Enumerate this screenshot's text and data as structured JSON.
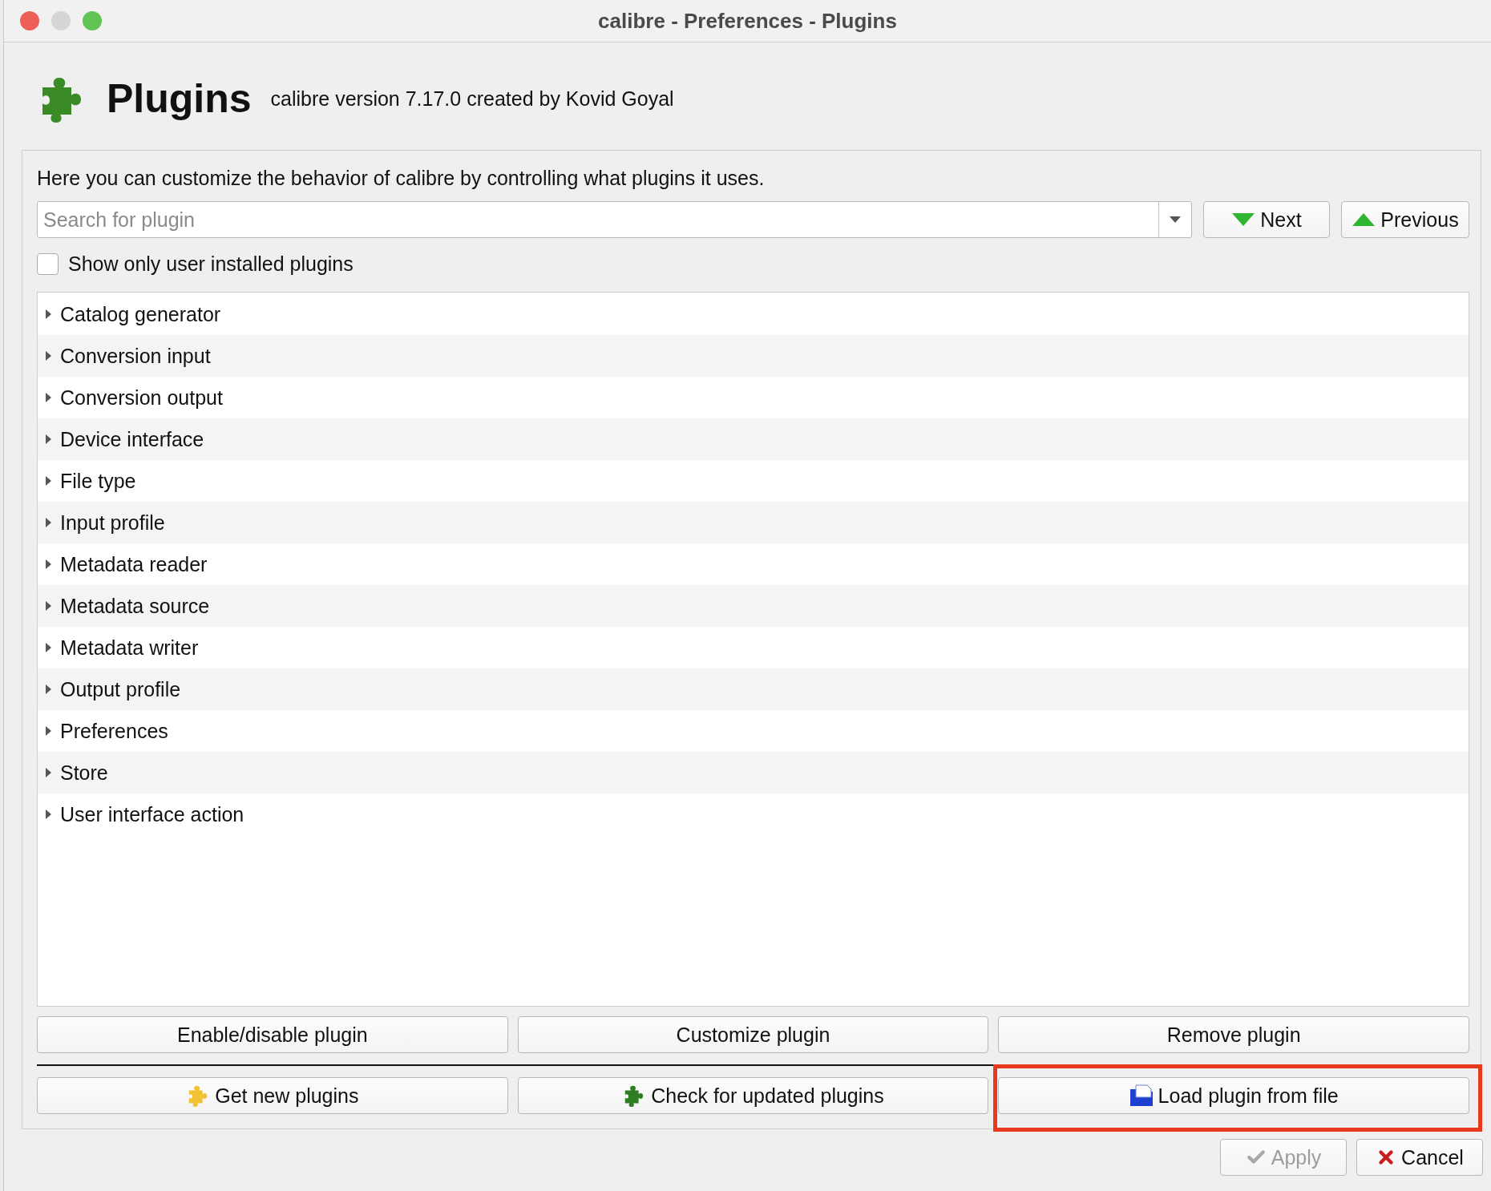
{
  "window": {
    "title": "calibre - Preferences - Plugins"
  },
  "header": {
    "title": "Plugins",
    "subtitle": "calibre version 7.17.0 created by Kovid Goyal"
  },
  "intro": "Here you can customize the behavior of calibre by controlling what plugins it uses.",
  "search": {
    "placeholder": "Search for plugin"
  },
  "nav_buttons": [
    {
      "kind": "down",
      "label": "Next"
    },
    {
      "kind": "up",
      "label": "Previous"
    }
  ],
  "filter": {
    "label": "Show only user installed plugins",
    "checked": false
  },
  "tree": [
    {
      "label": "Catalog generator",
      "expanded": false
    },
    {
      "label": "Conversion input",
      "expanded": false
    },
    {
      "label": "Conversion output",
      "expanded": false
    },
    {
      "label": "Device interface",
      "expanded": false
    },
    {
      "label": "File type",
      "expanded": false
    },
    {
      "label": "Input profile",
      "expanded": false
    },
    {
      "label": "Metadata reader",
      "expanded": false
    },
    {
      "label": "Metadata source",
      "expanded": false
    },
    {
      "label": "Metadata writer",
      "expanded": false
    },
    {
      "label": "Output profile",
      "expanded": false
    },
    {
      "label": "Preferences",
      "expanded": false
    },
    {
      "label": "Store",
      "expanded": false
    },
    {
      "label": "User interface action",
      "expanded": false
    }
  ],
  "plugin_buttons": [
    "Enable/disable plugin",
    "Customize plugin",
    "Remove plugin"
  ],
  "source_buttons": [
    {
      "kind": "get",
      "label": "Get new plugins",
      "highlighted": false
    },
    {
      "kind": "check",
      "label": "Check for updated plugins",
      "highlighted": false
    },
    {
      "kind": "load",
      "label": "Load plugin from file",
      "highlighted": true
    }
  ],
  "dialog_buttons": [
    {
      "kind": "apply",
      "label": "Apply",
      "disabled": true
    },
    {
      "kind": "cancel",
      "label": "Cancel",
      "disabled": false
    }
  ]
}
